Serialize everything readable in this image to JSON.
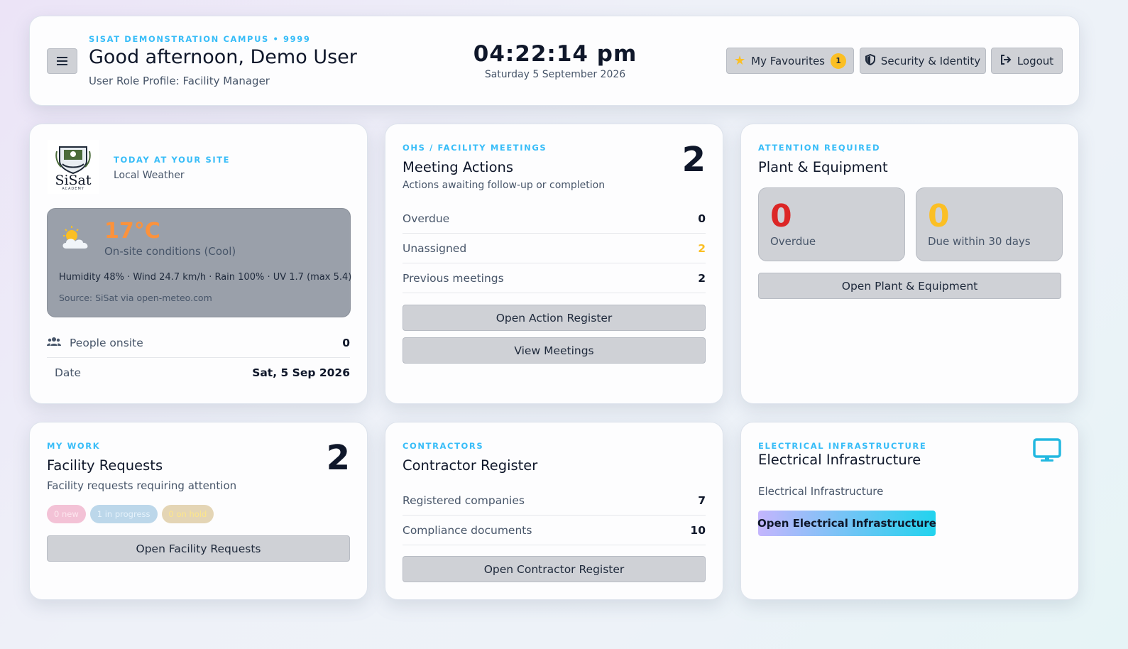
{
  "header": {
    "campus": "SISAT DEMONSTRATION CAMPUS • 9999",
    "greeting": "Good afternoon, Demo User",
    "role": "User Role Profile: Facility Manager",
    "time": "04:22:14 pm",
    "date": "Saturday 5 September 2026",
    "favourites_label": "My Favourites",
    "favourites_count": "1",
    "security_label": "Security & Identity",
    "logout_label": "Logout",
    "menu_icon": "hamburger-icon"
  },
  "site": {
    "eyebrow": "TODAY AT YOUR SITE",
    "subtitle": "Local Weather",
    "logo_text": "SiSat",
    "logo_sub": "ACADEMY",
    "weather": {
      "icon": "partly-cloudy-icon",
      "temp": "17°C",
      "condition": "On-site conditions (Cool)",
      "details": "Humidity 48% · Wind 24.7 km/h · Rain 100% · UV 1.7 (max 5.4)",
      "source": "Source: SiSat via open-meteo.com"
    },
    "people_label": "People onsite",
    "people_value": "0",
    "date_label": "Date",
    "date_value": "Sat, 5 Sep 2026"
  },
  "meetings": {
    "eyebrow": "OHS / FACILITY MEETINGS",
    "title": "Meeting Actions",
    "subtitle": "Actions awaiting follow-up or completion",
    "count": "2",
    "rows": [
      {
        "label": "Overdue",
        "value": "0"
      },
      {
        "label": "Unassigned",
        "value": "2"
      },
      {
        "label": "Previous meetings",
        "value": "2"
      }
    ],
    "btn_register": "Open Action Register",
    "btn_meetings": "View Meetings"
  },
  "plant": {
    "eyebrow": "ATTENTION REQUIRED",
    "title": "Plant & Equipment",
    "overdue_value": "0",
    "overdue_label": "Overdue",
    "due_value": "0",
    "due_label": "Due within 30 days",
    "btn": "Open Plant & Equipment"
  },
  "requests": {
    "eyebrow": "MY WORK",
    "title": "Facility Requests",
    "subtitle": "Facility requests requiring attention",
    "count": "2",
    "pills": [
      "0 new",
      "1 in progress",
      "0 on hold"
    ],
    "btn": "Open Facility Requests"
  },
  "contractors": {
    "eyebrow": "CONTRACTORS",
    "title": "Contractor Register",
    "rows": [
      {
        "label": "Registered companies",
        "value": "7"
      },
      {
        "label": "Compliance documents",
        "value": "10"
      }
    ],
    "btn": "Open Contractor Register"
  },
  "electrical": {
    "eyebrow": "ELECTRICAL INFRASTRUCTURE",
    "title": "Electrical Infrastructure",
    "subtitle": "Electrical Infrastructure",
    "btn": "Open Electrical Infrastructure",
    "icon": "monitor-icon"
  },
  "colors": {
    "accent": "#38bdf8",
    "danger": "#dc2626",
    "warning": "#fbbf24",
    "navy": "#0f172a"
  }
}
